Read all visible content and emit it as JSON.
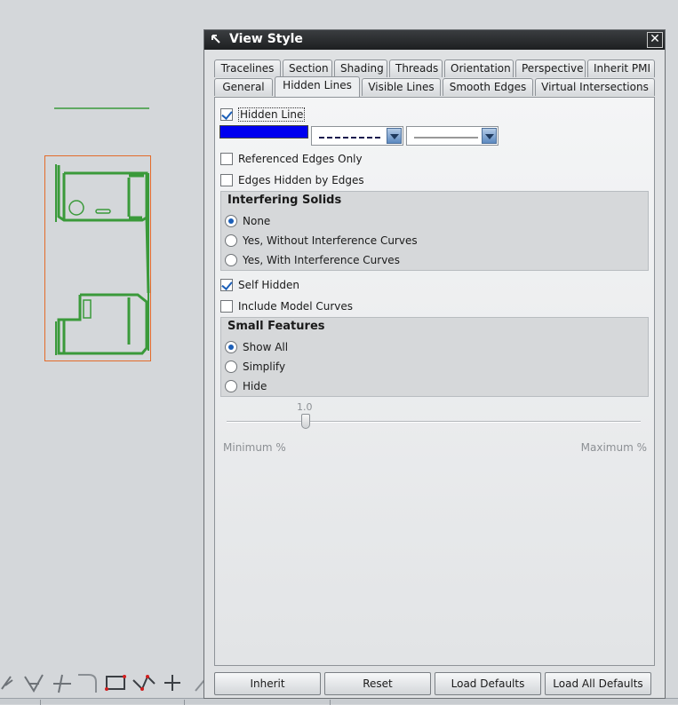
{
  "dialog": {
    "title": "View Style",
    "close_label": "✕",
    "tabs_row1": [
      {
        "label": "Tracelines"
      },
      {
        "label": "Section"
      },
      {
        "label": "Shading"
      },
      {
        "label": "Threads"
      },
      {
        "label": "Orientation"
      },
      {
        "label": "Perspective"
      },
      {
        "label": "Inherit PMI"
      }
    ],
    "tabs_row2": [
      {
        "label": "General"
      },
      {
        "label": "Hidden Lines",
        "active": true
      },
      {
        "label": "Visible Lines"
      },
      {
        "label": "Smooth Edges"
      },
      {
        "label": "Virtual Intersections"
      }
    ],
    "hidden_lines": {
      "hidden_line": {
        "label": "Hidden Line",
        "checked": true
      },
      "color": "#0000f0",
      "font_combo": {
        "selected": "dashed"
      },
      "width_combo": {
        "selected": "thin"
      },
      "referenced_edges_only": {
        "label": "Referenced Edges Only",
        "checked": false
      },
      "edges_hidden_by_edges": {
        "label": "Edges Hidden by Edges",
        "checked": false
      },
      "interfering_solids": {
        "title": "Interfering Solids",
        "options": [
          {
            "label": "None",
            "selected": true
          },
          {
            "label": "Yes, Without Interference Curves",
            "selected": false
          },
          {
            "label": "Yes, With Interference Curves",
            "selected": false
          }
        ]
      },
      "self_hidden": {
        "label": "Self Hidden",
        "checked": true
      },
      "include_model_curves": {
        "label": "Include Model Curves",
        "checked": false
      },
      "small_features": {
        "title": "Small Features",
        "options": [
          {
            "label": "Show All",
            "selected": true
          },
          {
            "label": "Simplify",
            "selected": false
          },
          {
            "label": "Hide",
            "selected": false
          }
        ]
      },
      "slider": {
        "value": "1.0",
        "min_label": "Minimum %",
        "max_label": "Maximum %"
      }
    },
    "buttons": {
      "inherit": "Inherit",
      "reset": "Reset",
      "load_defaults": "Load Defaults",
      "load_all_defaults": "Load All Defaults"
    }
  },
  "colors": {
    "drawing_geometry": "#3a9a3a",
    "view_border": "#e36b2a",
    "swatch": "#0000f0"
  },
  "toolbar_icons": [
    "pen-icon",
    "angle-icon",
    "trim-icon",
    "fillet-icon",
    "rectangle-icon",
    "polyline-icon",
    "point-icon"
  ]
}
